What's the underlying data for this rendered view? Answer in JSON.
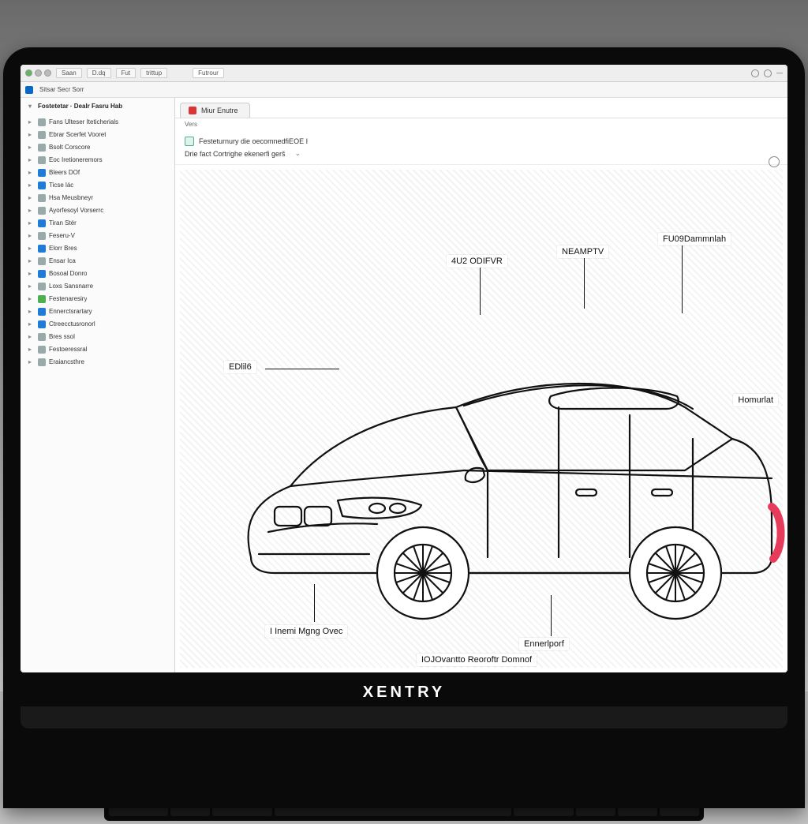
{
  "brand": "XENTRY",
  "chrome": {
    "title_segments": [
      "Saan",
      "D.dq",
      "",
      "Fut",
      "trittup"
    ],
    "tab_like": "Futrour"
  },
  "subbar": {
    "left": "Sitsar Secr Sorr"
  },
  "sidebar": {
    "header": "Fostetetar · Dealr Fasru Hab",
    "items": [
      {
        "label": "Fans Ulteser Iteticherials",
        "icon": "grey"
      },
      {
        "label": "Ebrar Scerfet Vooret",
        "icon": "grey"
      },
      {
        "label": "Bsolt Corscore",
        "icon": "grey"
      },
      {
        "label": "Eoc Iretioneremors",
        "icon": "grey"
      },
      {
        "label": "Bleers DOf",
        "icon": "blue"
      },
      {
        "label": "Ticse lác",
        "icon": "blue"
      },
      {
        "label": "Hsa Meusbneyr",
        "icon": "grey"
      },
      {
        "label": "Ayorfesoyl Vorserrc",
        "icon": "grey"
      },
      {
        "label": "Tiran Stér",
        "icon": "blue"
      },
      {
        "label": "Feseru-V",
        "icon": "grey"
      },
      {
        "label": "Elorr Bres",
        "icon": "blue"
      },
      {
        "label": "Ensar Ica",
        "icon": "grey"
      },
      {
        "label": "Bosoal Donro",
        "icon": "blue"
      },
      {
        "label": "Loxs Sansnarre",
        "icon": "grey"
      },
      {
        "label": "Festenaresiry",
        "icon": "green"
      },
      {
        "label": "Ennerctsrartary",
        "icon": "blue"
      },
      {
        "label": "Ctreecctusronorl",
        "icon": "blue"
      },
      {
        "label": "Bres ssol",
        "icon": "grey"
      },
      {
        "label": "Festoeressral",
        "icon": "grey"
      },
      {
        "label": "Eraiancsthre",
        "icon": "grey"
      }
    ]
  },
  "tabs": [
    {
      "label": "Miur Enutre",
      "icon_color": "#d33"
    }
  ],
  "tabs_sub": "Vers",
  "info": {
    "line1": "Festeturnury die oecomnedfiEOE I",
    "line2": "Drie fact Cortrighe ekenerfi gerš"
  },
  "callouts": {
    "engine": "EDlil6",
    "roof_left": "4U2 ODIFVR",
    "roof_mid": "NEAMPTV",
    "roof_right": "FU09Dammnlah",
    "rear": "Homurlat",
    "front_lower": "I Inemi Mgng Ovec",
    "under_mid": "Ennerlporf",
    "under_long": "IOJOvantto Reoroftr Domnof"
  }
}
